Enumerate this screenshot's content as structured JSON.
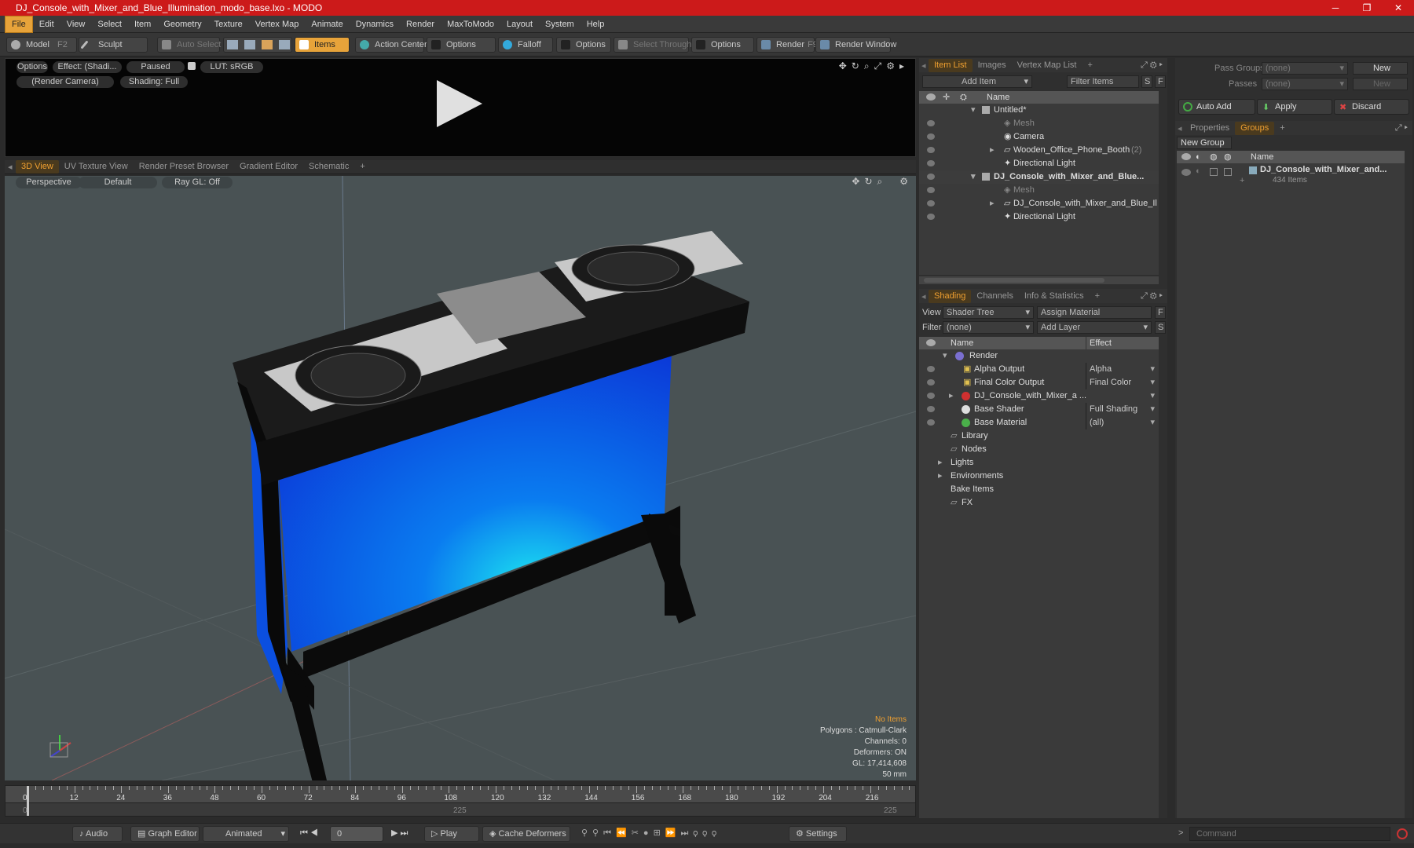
{
  "window": {
    "title": "DJ_Console_with_Mixer_and_Blue_Illumination_modo_base.lxo - MODO",
    "min": "─",
    "max": "❐",
    "close": "✕"
  },
  "menu": [
    "File",
    "Edit",
    "View",
    "Select",
    "Item",
    "Geometry",
    "Texture",
    "Vertex Map",
    "Animate",
    "Dynamics",
    "Render",
    "MaxToModo",
    "Layout",
    "System",
    "Help"
  ],
  "toolbar": {
    "model": "Model",
    "model_key": "F2",
    "sculpt": "Sculpt",
    "auto_select": "Auto Select",
    "items": "Items",
    "action_center": "Action Center",
    "options1": "Options",
    "falloff": "Falloff",
    "options2": "Options",
    "select_through": "Select Through",
    "options3": "Options",
    "render": "Render",
    "render_key": "F9",
    "render_window": "Render Window"
  },
  "render_view": {
    "options": "Options",
    "effect": "Effect: (Shadi...",
    "paused": "Paused",
    "lut": "LUT: sRGB",
    "camera": "(Render Camera)",
    "shading": "Shading: Full"
  },
  "view_tabs": [
    "3D View",
    "UV Texture View",
    "Render Preset Browser",
    "Gradient Editor",
    "Schematic"
  ],
  "viewport": {
    "perspective": "Perspective",
    "default": "Default",
    "raygl": "Ray GL: Off",
    "info": {
      "no_items": "No Items",
      "polygons": "Polygons : Catmull-Clark",
      "channels": "Channels: 0",
      "deformers": "Deformers: ON",
      "gl": "GL: 17,414,608",
      "focal": "50 mm"
    }
  },
  "timeline": {
    "ticks": [
      "0",
      "12",
      "24",
      "36",
      "48",
      "60",
      "72",
      "84",
      "96",
      "108",
      "120",
      "132",
      "144",
      "156",
      "168",
      "180",
      "192",
      "204",
      "216"
    ],
    "sub_start": "0",
    "sub_mid": "225",
    "sub_end": "225"
  },
  "bottombar": {
    "audio": "Audio",
    "graph_editor": "Graph Editor",
    "animated": "Animated",
    "frame": "0",
    "play": "Play",
    "cache_deformers": "Cache Deformers",
    "settings": "Settings",
    "command_placeholder": "Command"
  },
  "item_list": {
    "tabs": [
      "Item List",
      "Images",
      "Vertex Map List"
    ],
    "add_item": "Add Item",
    "filter_items": "Filter Items",
    "s": "S",
    "f": "F",
    "col_name": "Name",
    "rows": [
      {
        "label": "Untitled*",
        "indent": 0
      },
      {
        "label": "Mesh",
        "indent": 1
      },
      {
        "label": "Camera",
        "indent": 1
      },
      {
        "label": "Wooden_Office_Phone_Booth",
        "count": "(2)",
        "indent": 1
      },
      {
        "label": "Directional Light",
        "indent": 1
      },
      {
        "label": "DJ_Console_with_Mixer_and_Blue...",
        "indent": 0
      },
      {
        "label": "Mesh",
        "indent": 1
      },
      {
        "label": "DJ_Console_with_Mixer_and_Blue_Il ...",
        "indent": 1
      },
      {
        "label": "Directional Light",
        "indent": 1
      }
    ]
  },
  "shading": {
    "tabs": [
      "Shading",
      "Channels",
      "Info & Statistics"
    ],
    "view_label": "View",
    "view_value": "Shader Tree",
    "assign_material": "Assign Material",
    "filter_label": "Filter",
    "filter_value": "(none)",
    "add_layer": "Add Layer",
    "col_name": "Name",
    "col_effect": "Effect",
    "rows": [
      {
        "label": "Render",
        "effect": ""
      },
      {
        "label": "Alpha Output",
        "effect": "Alpha"
      },
      {
        "label": "Final Color Output",
        "effect": "Final Color"
      },
      {
        "label": "DJ_Console_with_Mixer_a ...",
        "effect": ""
      },
      {
        "label": "Base Shader",
        "effect": "Full Shading"
      },
      {
        "label": "Base Material",
        "effect": "(all)"
      },
      {
        "label": "Library",
        "effect": ""
      },
      {
        "label": "Nodes",
        "effect": ""
      },
      {
        "label": "Lights",
        "effect": ""
      },
      {
        "label": "Environments",
        "effect": ""
      },
      {
        "label": "Bake Items",
        "effect": ""
      },
      {
        "label": "FX",
        "effect": ""
      }
    ]
  },
  "groups": {
    "pass_groups": "Pass Groups",
    "passes": "Passes",
    "none": "(none)",
    "new": "New",
    "auto_add": "Auto Add",
    "apply": "Apply",
    "discard": "Discard",
    "tabs": [
      "Properties",
      "Groups"
    ],
    "new_group": "New Group",
    "col_name": "Name",
    "item_name": "DJ_Console_with_Mixer_and...",
    "item_count": "434 Items"
  }
}
